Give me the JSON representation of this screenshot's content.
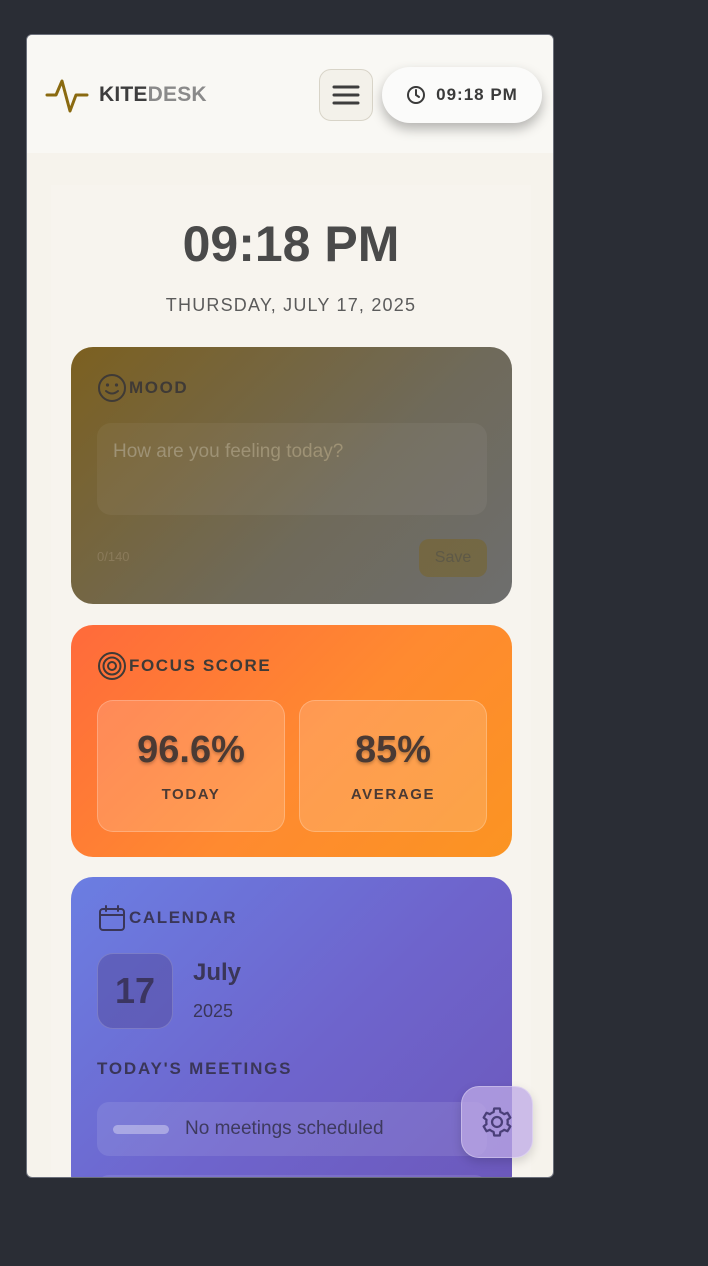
{
  "header": {
    "logo_part1": "KITE",
    "logo_part2": "DESK",
    "clock": "09:18 PM",
    "icons": {
      "logo": "pulse-icon",
      "menu": "hamburger-icon",
      "clock": "clock-icon"
    }
  },
  "hero": {
    "time": "09:18 PM",
    "date": "THURSDAY, JULY 17, 2025"
  },
  "mood": {
    "title": "MOOD",
    "icon": "smile-icon",
    "placeholder": "How are you feeling today?",
    "char_count": "0/140",
    "save_label": "Save"
  },
  "focus": {
    "title": "FOCUS SCORE",
    "icon": "target-icon",
    "today_value": "96.6%",
    "today_label": "TODAY",
    "average_value": "85%",
    "average_label": "AVERAGE"
  },
  "calendar": {
    "title": "CALENDAR",
    "icon": "calendar-icon",
    "day": "17",
    "month": "July",
    "year": "2025",
    "meetings_title": "TODAY'S MEETINGS",
    "no_meetings": "No meetings scheduled"
  },
  "fab": {
    "icon": "gear-icon"
  },
  "colors": {
    "background": "#2a2d35",
    "mood_card": "#7c6020",
    "focus_card": "#ff7a33",
    "calendar_card": "#6e64cc"
  }
}
